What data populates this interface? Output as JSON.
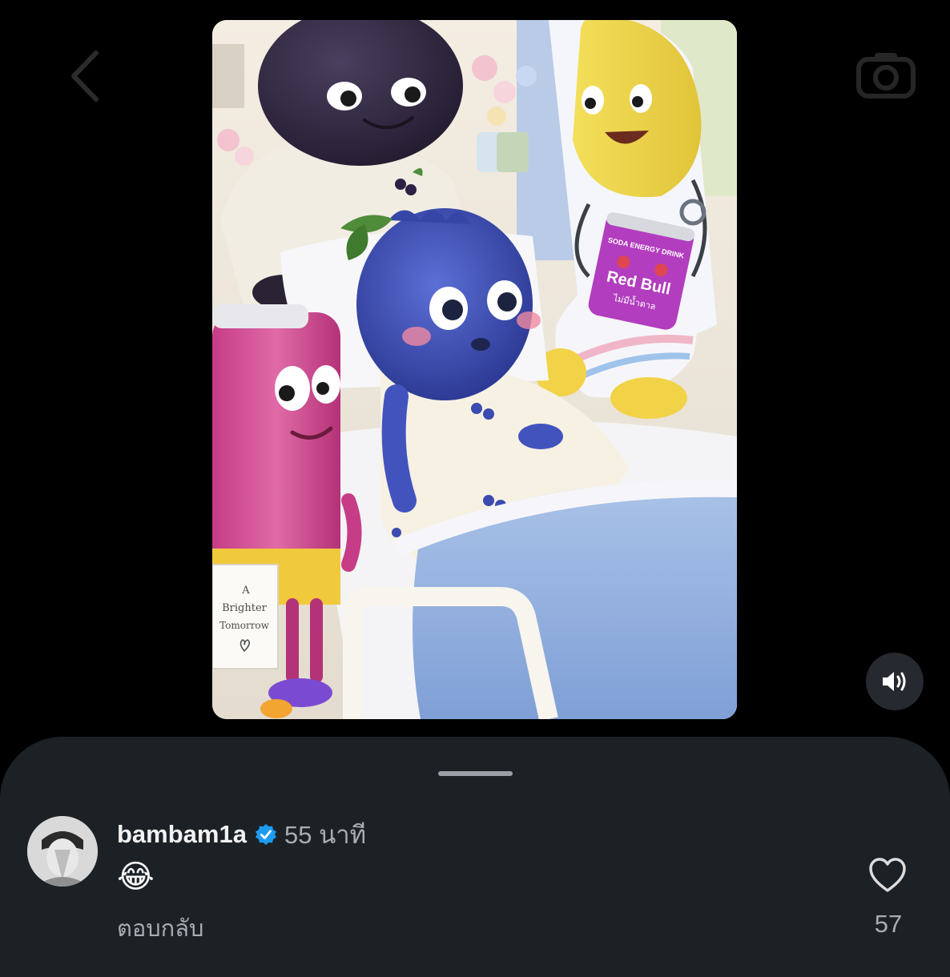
{
  "header": {
    "back_icon": "chevron-left-icon",
    "camera_icon": "camera-icon"
  },
  "media": {
    "sign_text_line1": "A",
    "sign_text_line2": "Brighter",
    "sign_text_line3": "Tomorrow",
    "can_brand": "Red Bull",
    "can_top_text": "SODA ENERGY DRINK",
    "can_thai_text": "ไม่มีน้ำตาล",
    "sound_icon": "speaker-icon"
  },
  "comment_sheet": {
    "comment": {
      "username": "bambam1a",
      "verified_icon": "verified-badge-icon",
      "time_ago": "55 นาที",
      "text": "😂",
      "reply_label": "ตอบกลับ",
      "like_icon": "heart-outline-icon",
      "like_count": "57"
    }
  },
  "colors": {
    "background": "#000000",
    "sheet": "#1c2126",
    "verified": "#1d9bf0",
    "secondary_text": "#a8adb3"
  }
}
